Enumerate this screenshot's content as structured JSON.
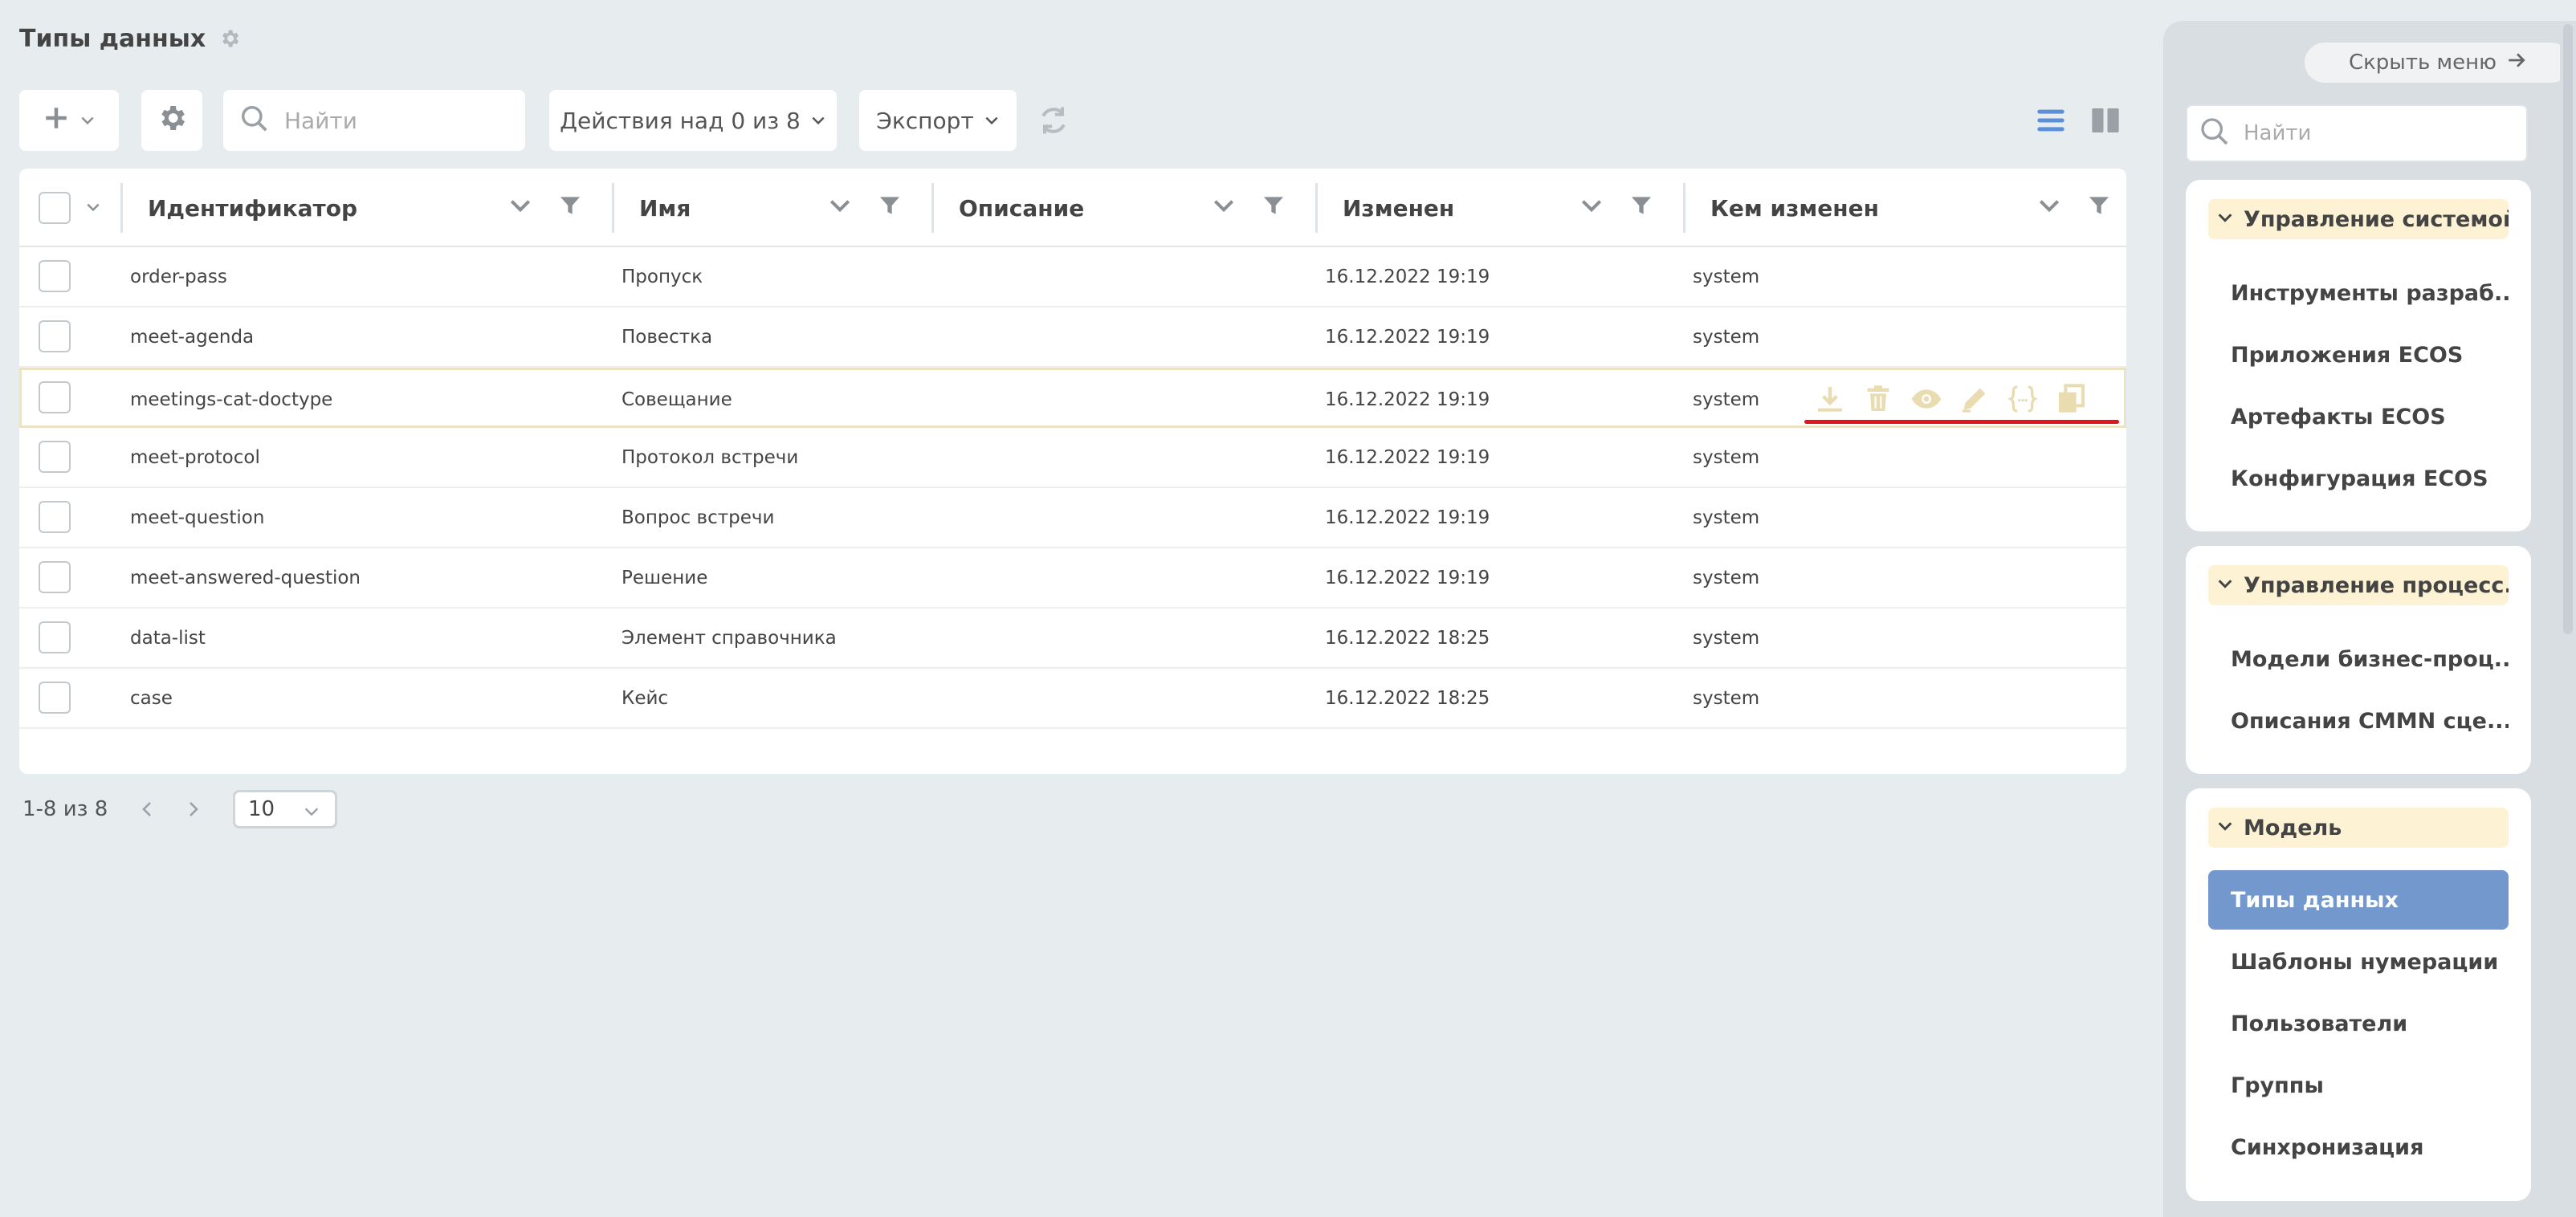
{
  "page": {
    "title": "Типы данных"
  },
  "toolbar": {
    "search_placeholder": "Найти",
    "actions_label": "Действия над 0 из 8",
    "export_label": "Экспорт"
  },
  "table": {
    "columns": [
      "Идентификатор",
      "Имя",
      "Описание",
      "Изменен",
      "Кем изменен"
    ],
    "rows": [
      {
        "id": "order-pass",
        "name": "Пропуск",
        "description": "",
        "modified": "16.12.2022 19:19",
        "modified_by": "system"
      },
      {
        "id": "meet-agenda",
        "name": "Повестка",
        "description": "",
        "modified": "16.12.2022 19:19",
        "modified_by": "system"
      },
      {
        "id": "meetings-cat-doctype",
        "name": "Совещание",
        "description": "",
        "modified": "16.12.2022 19:19",
        "modified_by": "system"
      },
      {
        "id": "meet-protocol",
        "name": "Протокол встречи",
        "description": "",
        "modified": "16.12.2022 19:19",
        "modified_by": "system"
      },
      {
        "id": "meet-question",
        "name": "Вопрос встречи",
        "description": "",
        "modified": "16.12.2022 19:19",
        "modified_by": "system"
      },
      {
        "id": "meet-answered-question",
        "name": "Решение",
        "description": "",
        "modified": "16.12.2022 19:19",
        "modified_by": "system"
      },
      {
        "id": "data-list",
        "name": "Элемент справочника",
        "description": "",
        "modified": "16.12.2022 18:25",
        "modified_by": "system"
      },
      {
        "id": "case",
        "name": "Кейс",
        "description": "",
        "modified": "16.12.2022 18:25",
        "modified_by": "system"
      }
    ],
    "row_action_icons": [
      "download-icon",
      "trash-icon",
      "eye-icon",
      "pencil-icon",
      "json-braces-icon",
      "copy-icon"
    ]
  },
  "pager": {
    "range": "1-8 из 8",
    "page_size": "10"
  },
  "sidebar": {
    "hide_menu_label": "Скрыть меню",
    "search_placeholder": "Найти",
    "groups": [
      {
        "title": "Управление системой",
        "items": [
          "Инструменты разраб...",
          "Приложения ECOS",
          "Артефакты ECOS",
          "Конфигурация ECOS"
        ]
      },
      {
        "title": "Управление процесс...",
        "items": [
          "Модели бизнес-проц...",
          "Описания CMMN сце..."
        ]
      },
      {
        "title": "Модель",
        "items": [
          "Типы данных",
          "Шаблоны нумерации",
          "Пользователи",
          "Группы",
          "Синхронизация"
        ]
      }
    ],
    "active_item": "Типы данных"
  },
  "colors": {
    "background": "#e7ecef",
    "accent_blue": "#7298cd",
    "group_header_bg": "#fdf2d4",
    "row_action_icon": "#e8dcb0",
    "annotation_red": "#e2141e"
  }
}
